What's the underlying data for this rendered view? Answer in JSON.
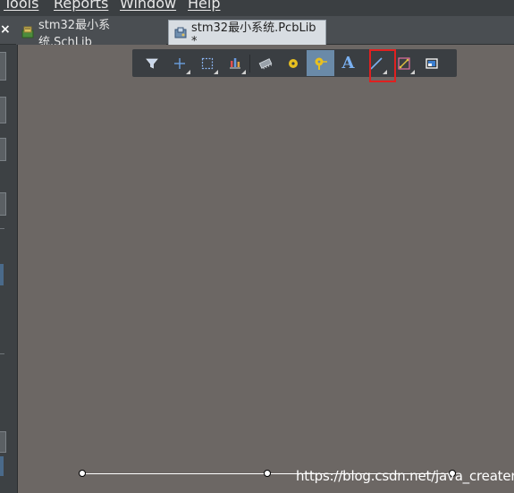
{
  "menu": {
    "items": [
      "Tools",
      "Reports",
      "Window",
      "Help"
    ]
  },
  "tabs": {
    "close_glyph": "×",
    "items": [
      {
        "label": "stm32最小系统.SchLib",
        "icon": "schlib-icon",
        "active": false
      },
      {
        "label": "stm32最小系统.PcbLib *",
        "icon": "pcblib-icon",
        "active": true
      }
    ]
  },
  "toolbar": {
    "buttons": [
      {
        "name": "filter-icon",
        "has_dropdown": false,
        "selected": false
      },
      {
        "name": "crosshair-move-icon",
        "has_dropdown": true,
        "selected": false
      },
      {
        "name": "select-rectangle-icon",
        "has_dropdown": true,
        "selected": false
      },
      {
        "name": "align-icon",
        "has_dropdown": true,
        "selected": false
      },
      {
        "name": "component-icon",
        "has_dropdown": false,
        "selected": false
      },
      {
        "name": "pad-icon",
        "has_dropdown": false,
        "selected": false
      },
      {
        "name": "via-icon",
        "has_dropdown": false,
        "selected": true
      },
      {
        "name": "text-string-icon",
        "has_dropdown": false,
        "selected": false
      },
      {
        "name": "line-icon",
        "has_dropdown": true,
        "selected": false,
        "highlighted": true
      },
      {
        "name": "dimension-icon",
        "has_dropdown": true,
        "selected": false
      },
      {
        "name": "region-icon",
        "has_dropdown": false,
        "selected": false
      }
    ],
    "text_glyph": "A"
  },
  "canvas": {
    "watermark": "https://blog.csdn.net/java_creater"
  },
  "colors": {
    "canvas": "#6c6764",
    "toolbar_bg": "#3a3e42",
    "selected_button": "#6a8aa8",
    "highlight_box": "#e02020",
    "menubar": "#3b3f42"
  }
}
